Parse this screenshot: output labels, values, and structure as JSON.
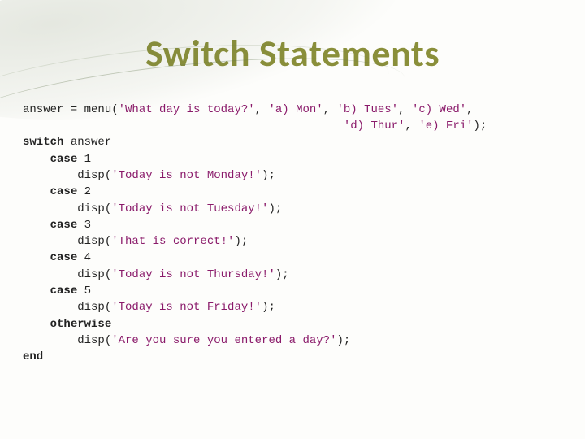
{
  "title": "Switch Statements",
  "code": {
    "l1a": "answer = menu(",
    "l1s1": "'What day is today?'",
    "l1b": ", ",
    "l1s2": "'a) Mon'",
    "l1c": ", ",
    "l1s3": "'b) Tues'",
    "l1d": ", ",
    "l1s4": "'c) Wed'",
    "l1e": ",",
    "l2pad": "                                               ",
    "l2s1": "'d) Thur'",
    "l2a": ", ",
    "l2s2": "'e) Fri'",
    "l2b": ");",
    "kw_switch": "switch",
    "switch_expr": " answer",
    "kw_case": "case",
    "case1": " 1",
    "case2": " 2",
    "case3": " 3",
    "case4": " 4",
    "case5": " 5",
    "disp": "        disp(",
    "close": ");",
    "s_mon": "'Today is not Monday!'",
    "s_tue": "'Today is not Tuesday!'",
    "s_corr": "'That is correct!'",
    "s_thu": "'Today is not Thursday!'",
    "s_fri": "'Today is not Friday!'",
    "s_oth": "'Are you sure you entered a day?'",
    "kw_otherwise": "otherwise",
    "kw_end": "end",
    "ind4": "    "
  }
}
